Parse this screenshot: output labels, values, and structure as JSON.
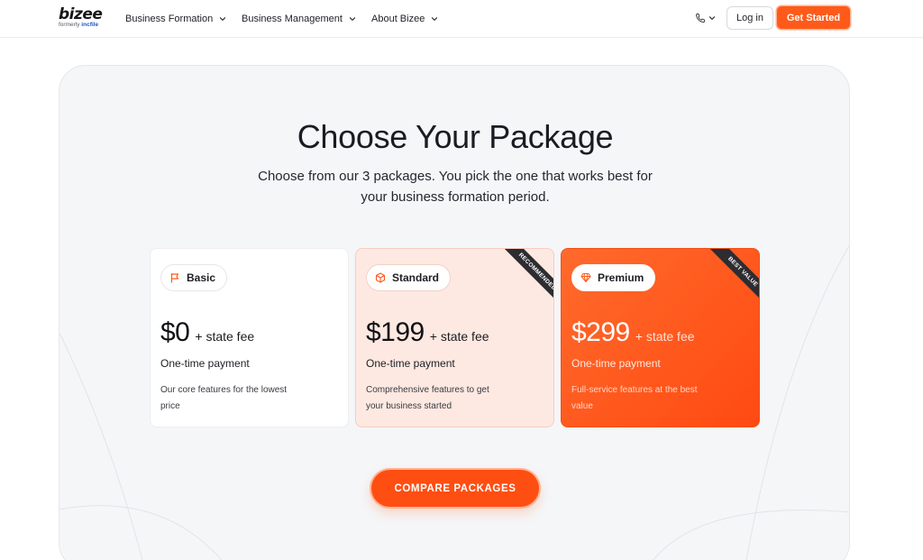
{
  "header": {
    "logo": {
      "brand": "bizee",
      "sub_prefix": "formerly",
      "sub_brand": "incfile"
    },
    "nav": [
      {
        "label": "Business Formation"
      },
      {
        "label": "Business Management"
      },
      {
        "label": "About Bizee"
      }
    ],
    "phone_icon": "phone-icon",
    "login_label": "Log in",
    "get_started_label": "Get Started",
    "accent_color": "#ff5a1a"
  },
  "main": {
    "title": "Choose Your Package",
    "subtitle": "Choose from our 3 packages. You pick the one that works best for your business formation period.",
    "packages": [
      {
        "name": "Basic",
        "icon": "flag-icon",
        "price": "$0",
        "fee": "+ state fee",
        "payment": "One-time payment",
        "description": "Our core features for the lowest price",
        "ribbon": ""
      },
      {
        "name": "Standard",
        "icon": "box-icon",
        "price": "$199",
        "fee": "+ state fee",
        "payment": "One-time payment",
        "description": "Comprehensive features to get your business started",
        "ribbon": "RECOMMENDED"
      },
      {
        "name": "Premium",
        "icon": "diamond-icon",
        "price": "$299",
        "fee": "+ state fee",
        "payment": "One-time payment",
        "description": "Full-service features at the best value",
        "ribbon": "BEST VALUE"
      }
    ],
    "compare_label": "COMPARE PACKAGES"
  }
}
